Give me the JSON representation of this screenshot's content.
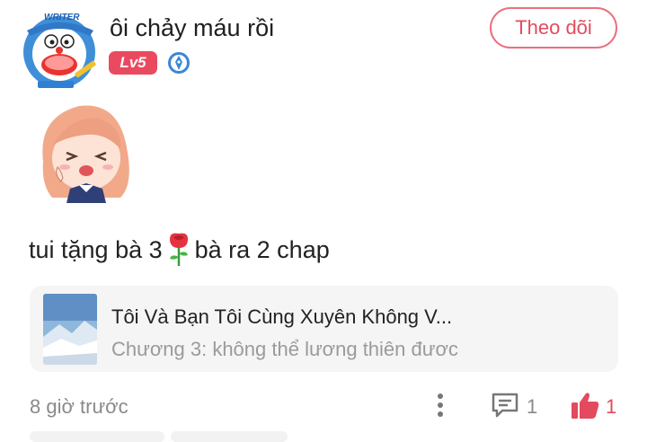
{
  "author": {
    "name": "ôi chảy máu rồi",
    "level_badge": "Lv5",
    "avatar_label": "WRITER"
  },
  "follow_button_label": "Theo dõi",
  "comment": {
    "text_before_emoji": "tui tặng bà 3",
    "emoji": "rose-icon",
    "text_after_emoji": "bà ra 2 chap"
  },
  "story": {
    "title": "Tôi Và Bạn Tôi Cùng Xuyên Không V...",
    "chapter": "Chương 3: không thể lương thiên đươc"
  },
  "footer": {
    "timestamp": "8 giờ trước",
    "reply_count": "1",
    "like_count": "1"
  },
  "colors": {
    "accent": "#e44b5e",
    "badge": "#ea4a5f",
    "card_bg": "#f5f5f5",
    "muted_text": "#8a8a8a",
    "verify_blue": "#3a86d8"
  }
}
